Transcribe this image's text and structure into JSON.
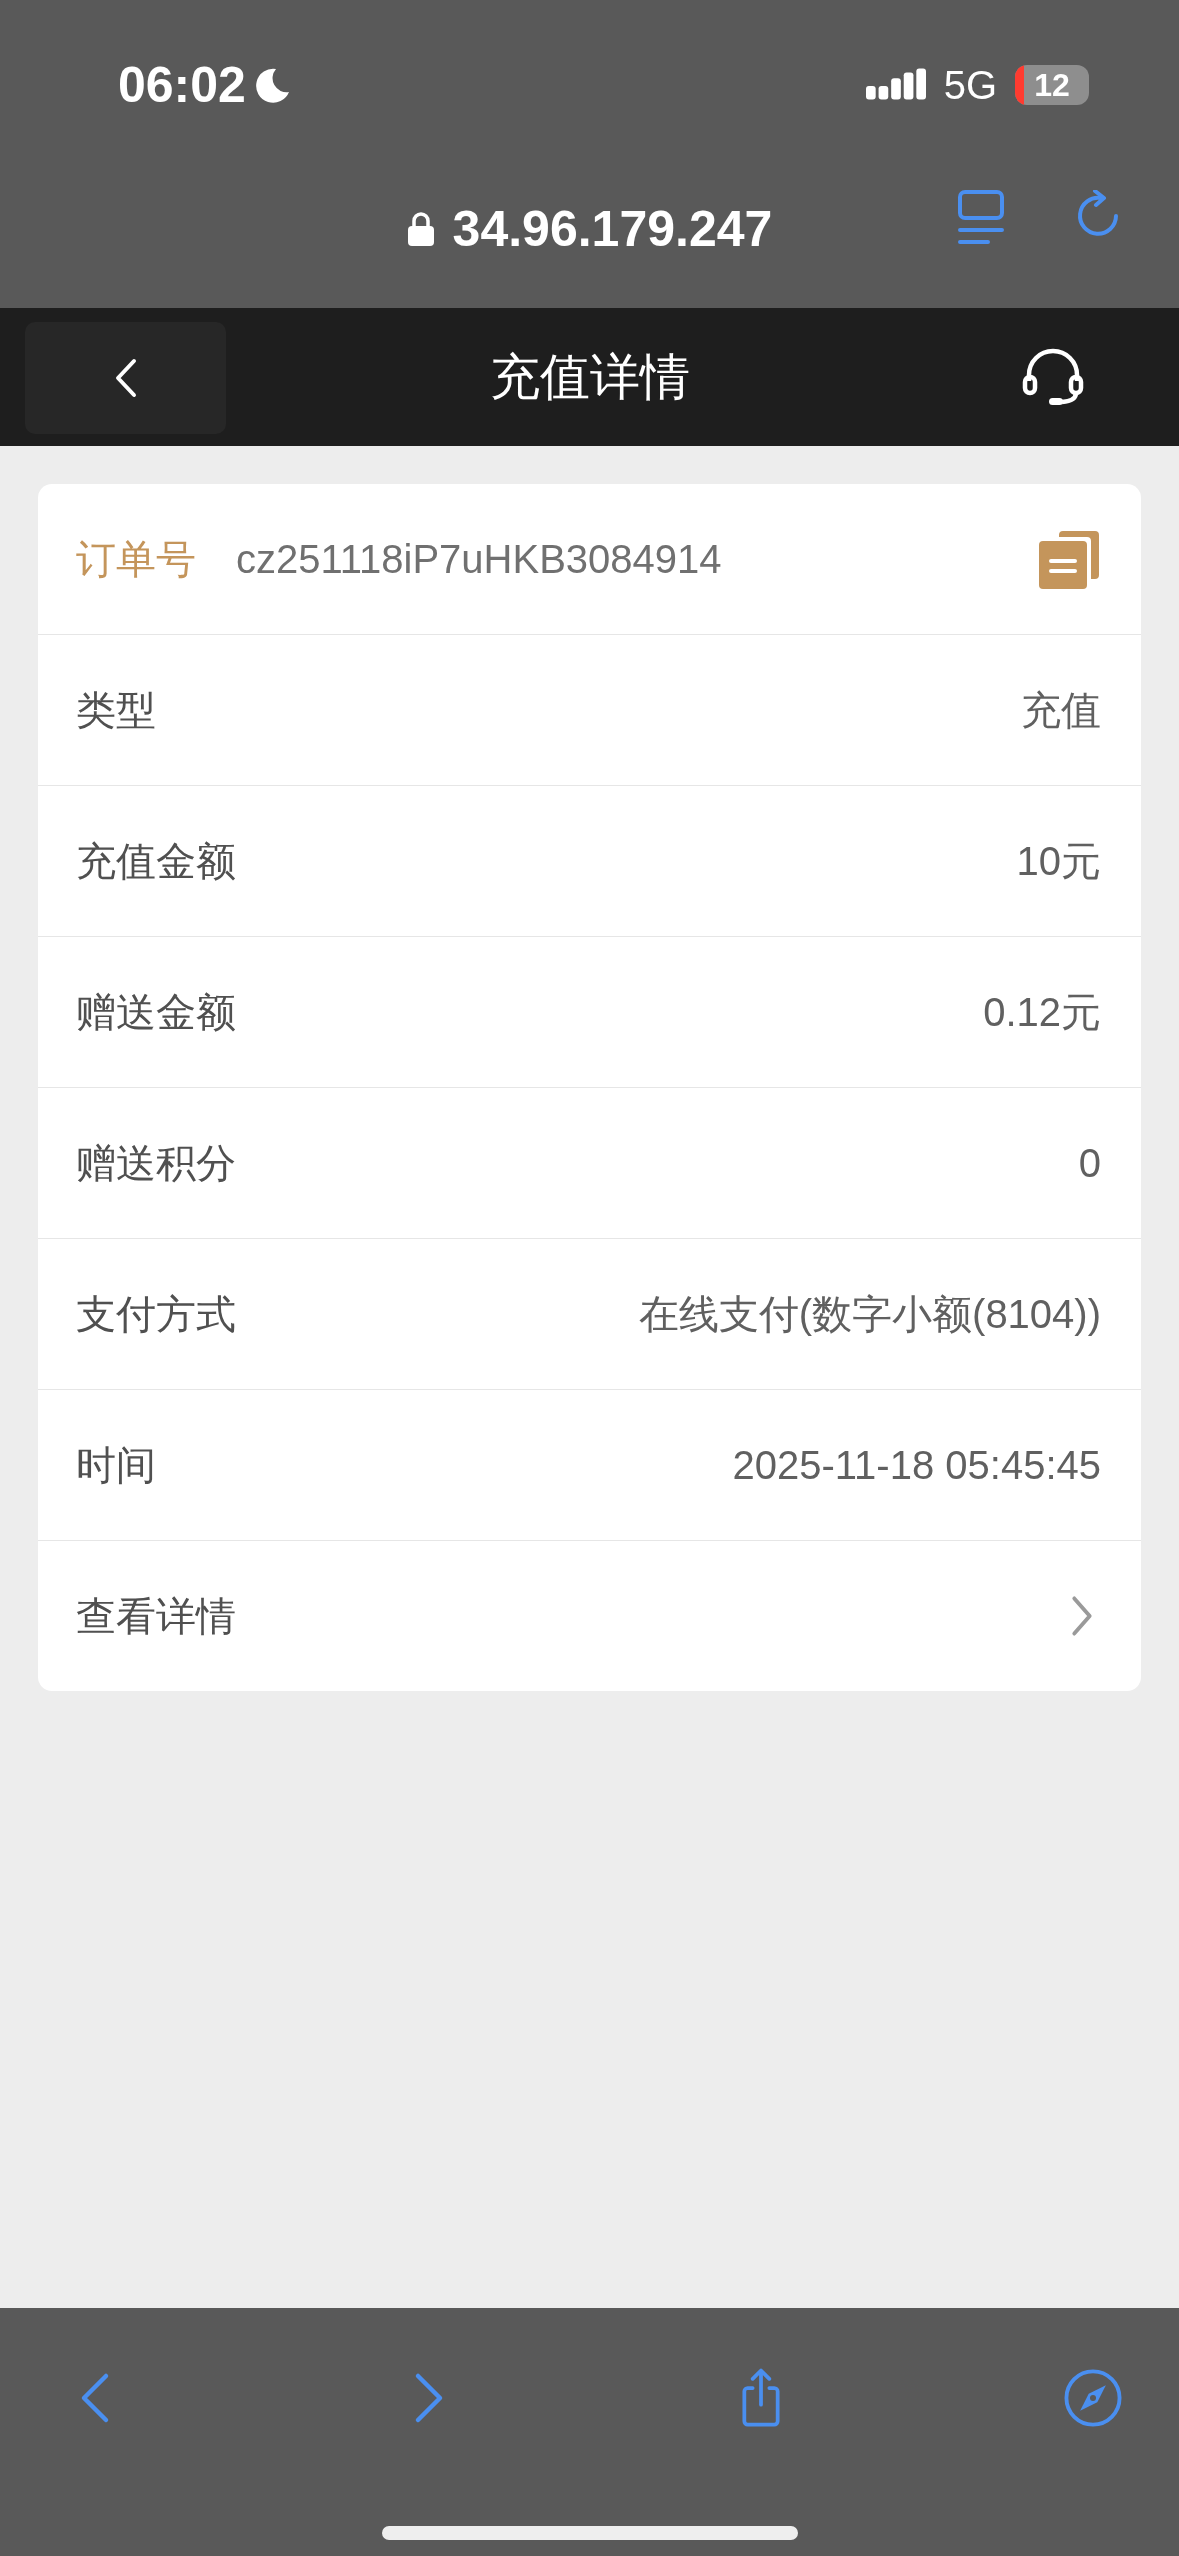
{
  "status_bar": {
    "time": "06:02",
    "network": "5G",
    "battery": "12"
  },
  "browser": {
    "url": "34.96.179.247"
  },
  "header": {
    "title": "充值详情"
  },
  "order": {
    "label": "订单号",
    "value": "cz251118iP7uHKB3084914"
  },
  "rows": [
    {
      "kind": "text",
      "label": "类型",
      "value": "充值"
    },
    {
      "kind": "text",
      "label": "充值金额",
      "value": "10元"
    },
    {
      "kind": "text",
      "label": "赠送金额",
      "value": "0.12元"
    },
    {
      "kind": "text",
      "label": "赠送积分",
      "value": "0"
    },
    {
      "kind": "text",
      "label": "支付方式",
      "value": "在线支付(数字小额(8104))"
    },
    {
      "kind": "text",
      "label": "时间",
      "value": "2025-11-18 05:45:45"
    },
    {
      "kind": "link",
      "label": "查看详情"
    }
  ]
}
